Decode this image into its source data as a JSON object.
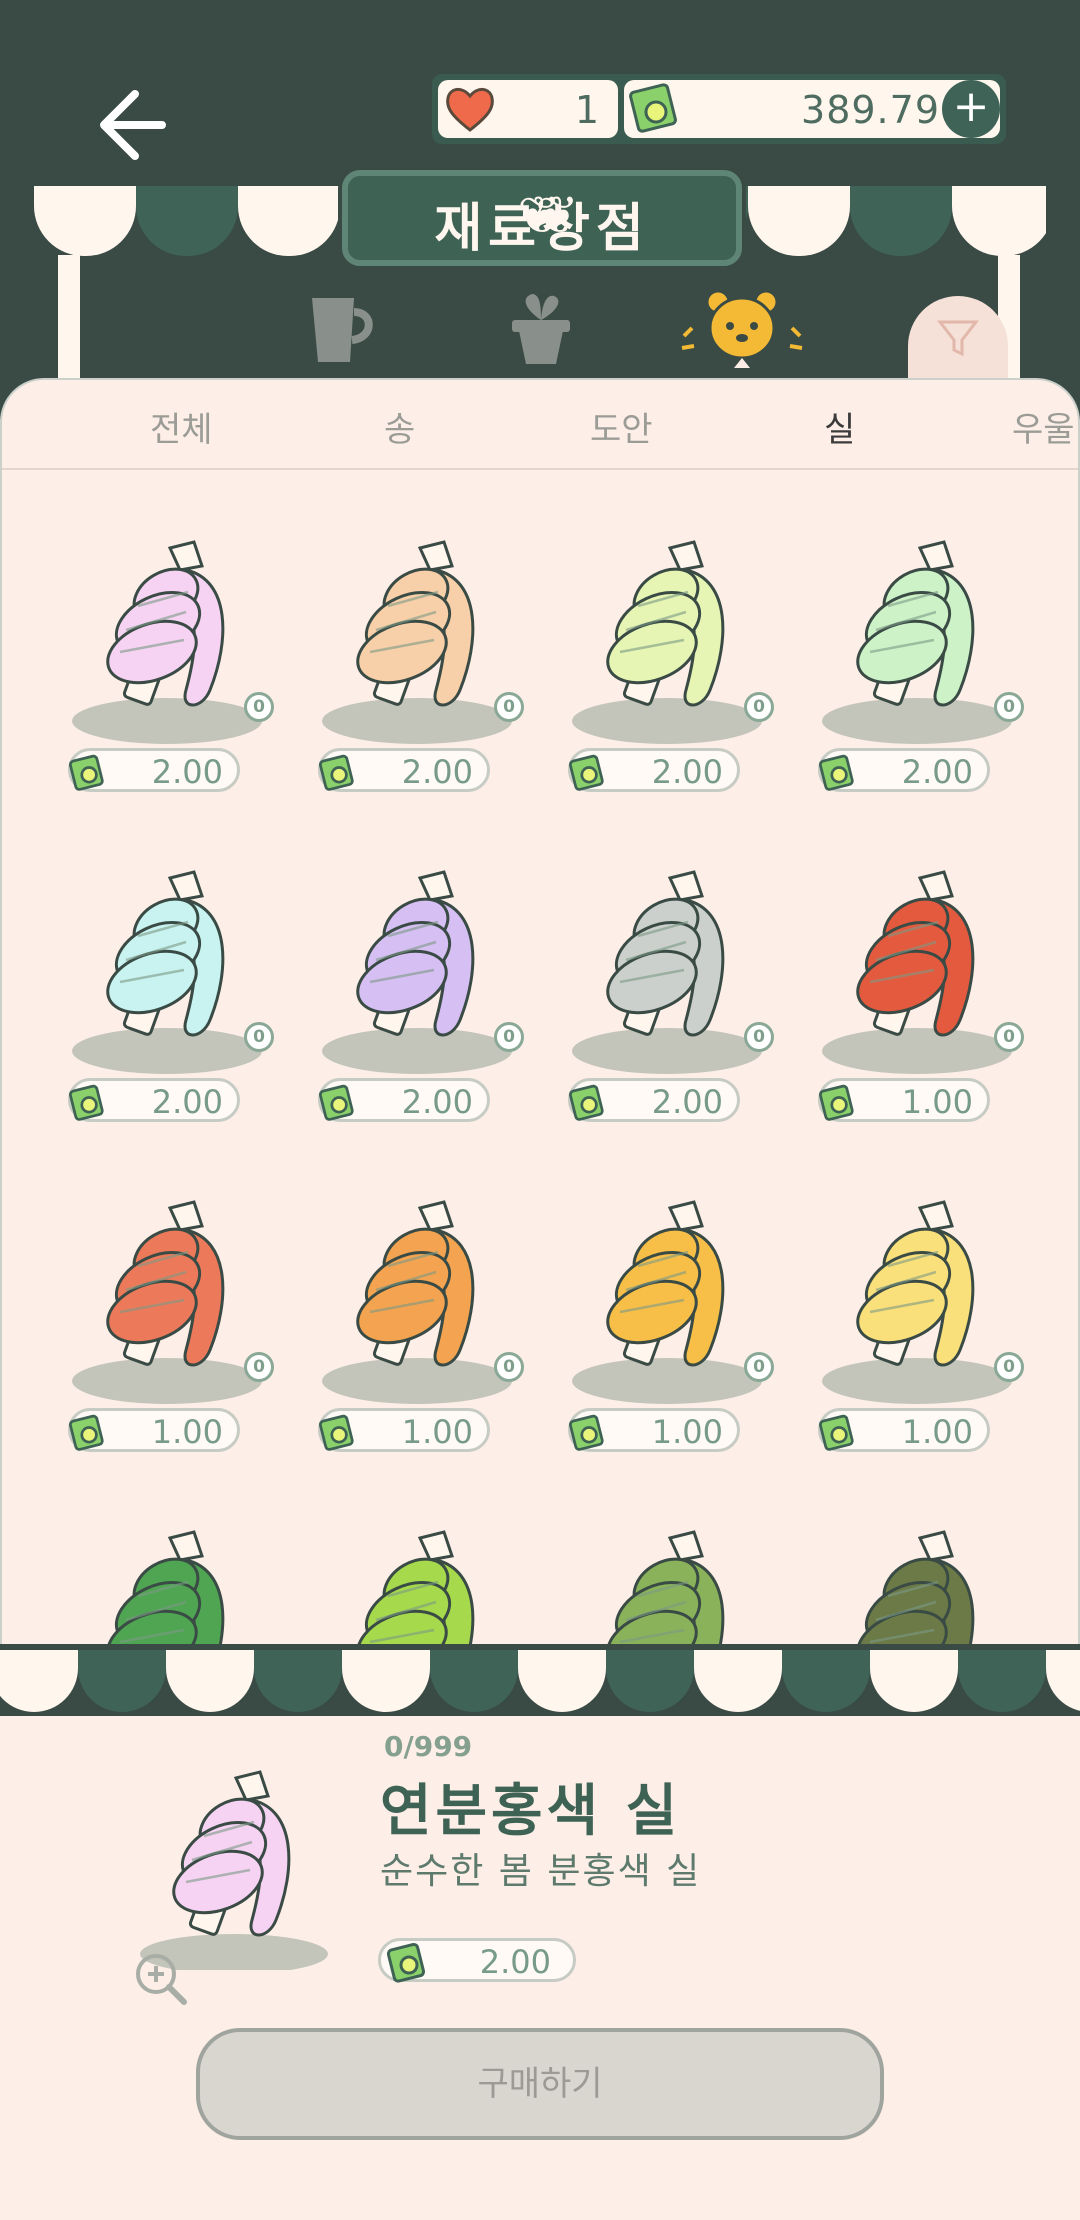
{
  "header": {
    "hearts": "1",
    "money": "389.79",
    "plus_label": "+",
    "shop_title": "재료상점"
  },
  "colors": {
    "header_bg": "#3a4b45",
    "accent_green": "#3e6254",
    "sheet_bg": "#fdefe8"
  },
  "categories": [
    {
      "icon": "cup-icon"
    },
    {
      "icon": "flowerpot-icon"
    },
    {
      "icon": "bear-icon",
      "active": true
    }
  ],
  "subtabs": [
    {
      "label": "전체"
    },
    {
      "label": "송"
    },
    {
      "label": "도안"
    },
    {
      "label": "실",
      "active": true
    },
    {
      "label": "우울"
    }
  ],
  "items": [
    {
      "color": "#f6d3f2",
      "count": "0",
      "price": "2.00"
    },
    {
      "color": "#f7cfa8",
      "count": "0",
      "price": "2.00"
    },
    {
      "color": "#e6f5b4",
      "count": "0",
      "price": "2.00"
    },
    {
      "color": "#cdf2c7",
      "count": "0",
      "price": "2.00"
    },
    {
      "color": "#c9f3f1",
      "count": "0",
      "price": "2.00"
    },
    {
      "color": "#d6bff2",
      "count": "0",
      "price": "2.00"
    },
    {
      "color": "#cbd0cc",
      "count": "0",
      "price": "2.00"
    },
    {
      "color": "#e45a3f",
      "count": "0",
      "price": "1.00"
    },
    {
      "color": "#ec7a5a",
      "count": "0",
      "price": "1.00"
    },
    {
      "color": "#f4a450",
      "count": "0",
      "price": "1.00"
    },
    {
      "color": "#f7bf48",
      "count": "0",
      "price": "1.00"
    },
    {
      "color": "#fae07a",
      "count": "0",
      "price": "1.00"
    },
    {
      "color": "#4fa552"
    },
    {
      "color": "#a6d94c"
    },
    {
      "color": "#8ab25a"
    },
    {
      "color": "#6b7a46"
    }
  ],
  "detail": {
    "stock": "0/999",
    "name": "연분홍색 실",
    "description": "순수한 봄 분홍색 실",
    "price": "2.00",
    "color": "#f6d3f2",
    "buy_label": "구매하기"
  }
}
